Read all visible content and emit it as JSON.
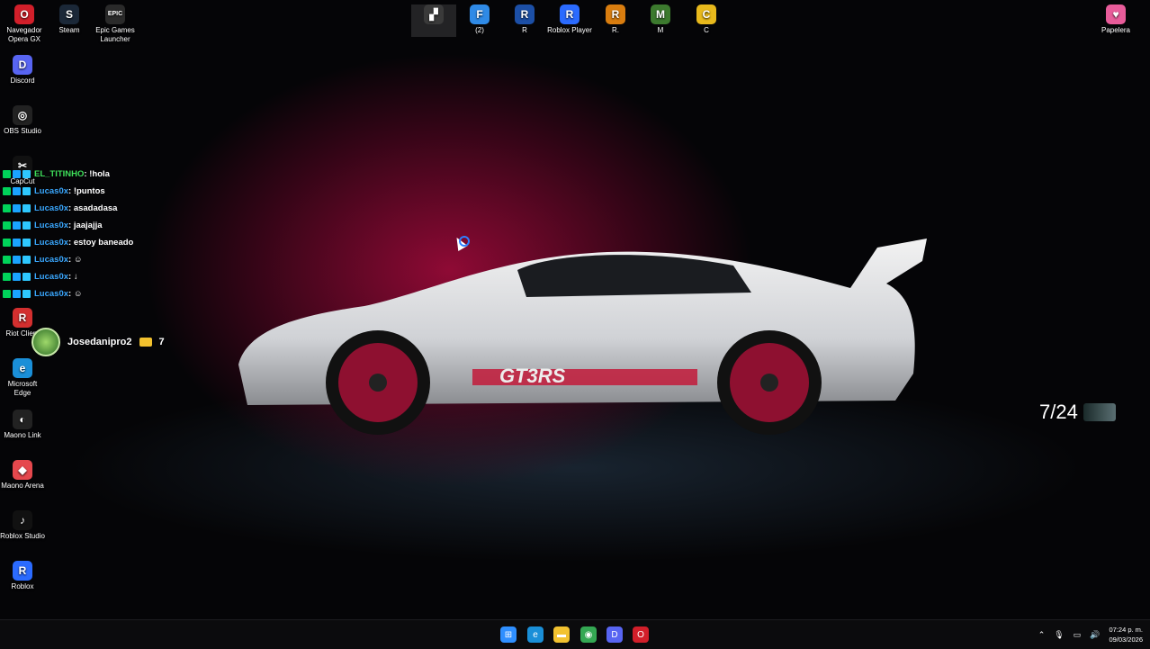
{
  "desktop": {
    "top_icons": [
      {
        "id": "opera",
        "label": "Navegador Opera GX",
        "icon": "opera-icon",
        "color": "#d21f2a",
        "glyph": "O"
      },
      {
        "id": "steam",
        "label": "Steam",
        "icon": "steam-icon",
        "color": "#1b2838",
        "glyph": "S"
      },
      {
        "id": "epic",
        "label": "Epic Games Launcher",
        "icon": "epic-icon",
        "color": "#2a2a2a",
        "glyph": "EPIC"
      },
      {
        "id": "app1",
        "label": "",
        "icon": "app-icon",
        "color": "#3a3a3a",
        "glyph": "▞"
      },
      {
        "id": "app2",
        "label": "(2)",
        "icon": "app-icon",
        "color": "#2f8ae6",
        "glyph": "F"
      },
      {
        "id": "rocket",
        "label": "R",
        "icon": "rocket-league-icon",
        "color": "#1c4fa6",
        "glyph": "R"
      },
      {
        "id": "roblox-player",
        "label": "Roblox Player",
        "icon": "roblox-icon",
        "color": "#2b6bff",
        "glyph": "R"
      },
      {
        "id": "r2",
        "label": "R.",
        "icon": "game-icon",
        "color": "#d97d0f",
        "glyph": "R"
      },
      {
        "id": "minecraft",
        "label": "M",
        "icon": "minecraft-icon",
        "color": "#3c7a2e",
        "glyph": "M"
      },
      {
        "id": "c",
        "label": "C",
        "icon": "game-icon",
        "color": "#e8b91c",
        "glyph": "C"
      },
      {
        "id": "recycle",
        "label": "Papelera",
        "icon": "recycle-bin-icon",
        "color": "#e85c9a",
        "glyph": "♥"
      }
    ],
    "left_icons": [
      {
        "id": "discord",
        "label": "Discord",
        "icon": "discord-icon",
        "color": "#5865f2",
        "glyph": "D"
      },
      {
        "id": "obs",
        "label": "OBS Studio",
        "icon": "obs-icon",
        "color": "#222",
        "glyph": "◎"
      },
      {
        "id": "capcut",
        "label": "CapCut",
        "icon": "capcut-icon",
        "color": "#111",
        "glyph": "✂"
      },
      {
        "id": "riot",
        "label": "Riot Client",
        "icon": "riot-icon",
        "color": "#d32f2f",
        "glyph": "R"
      },
      {
        "id": "edge",
        "label": "Microsoft Edge",
        "icon": "edge-icon",
        "color": "#1a8fd8",
        "glyph": "e"
      },
      {
        "id": "maono-link",
        "label": "Maono Link",
        "icon": "maono-icon",
        "color": "#222",
        "glyph": "◐"
      },
      {
        "id": "maono-arena",
        "label": "Maono Arena",
        "icon": "maono-arena-icon",
        "color": "#e5484d",
        "glyph": "◆"
      },
      {
        "id": "roblox-studio",
        "label": "Roblox Studio",
        "icon": "roblox-studio-icon",
        "color": "#111",
        "glyph": "♪"
      },
      {
        "id": "roblox",
        "label": "Roblox",
        "icon": "roblox-icon",
        "color": "#2b6bff",
        "glyph": "R"
      }
    ]
  },
  "chat": {
    "messages": [
      {
        "user": "EL_TITINHO",
        "text": ": !hola",
        "user_class": "user-green"
      },
      {
        "user": "Lucas0x",
        "text": ": !puntos",
        "user_class": "user-name"
      },
      {
        "user": "Lucas0x",
        "text": ": asadadasa",
        "user_class": "user-name"
      },
      {
        "user": "Lucas0x",
        "text": ": jaajajja",
        "user_class": "user-name"
      },
      {
        "user": "Lucas0x",
        "text": ": estoy baneado",
        "user_class": "user-name"
      },
      {
        "user": "Lucas0x",
        "text": ": ☺",
        "user_class": "user-name"
      },
      {
        "user": "Lucas0x",
        "text": ": ↓",
        "user_class": "user-name"
      },
      {
        "user": "Lucas0x",
        "text": ": ☺",
        "user_class": "user-name"
      }
    ]
  },
  "viewer": {
    "name": "Josedanipro2",
    "points": "7"
  },
  "counter": {
    "text": "7/24"
  },
  "taskbar": {
    "apps": [
      {
        "id": "start",
        "icon": "windows-start-icon",
        "color": "#2f8fff",
        "glyph": "⊞"
      },
      {
        "id": "edge",
        "icon": "edge-icon",
        "color": "#1a8fd8",
        "glyph": "e"
      },
      {
        "id": "explorer",
        "icon": "file-explorer-icon",
        "color": "#f2c230",
        "glyph": "▬"
      },
      {
        "id": "chrome",
        "icon": "chrome-icon",
        "color": "#34a853",
        "glyph": "◉"
      },
      {
        "id": "discord",
        "icon": "discord-icon",
        "color": "#5865f2",
        "glyph": "D"
      },
      {
        "id": "opera",
        "icon": "opera-icon",
        "color": "#d21f2a",
        "glyph": "O"
      }
    ],
    "clock": {
      "time": "07:24 p. m.",
      "date": "09/03/2026"
    }
  }
}
